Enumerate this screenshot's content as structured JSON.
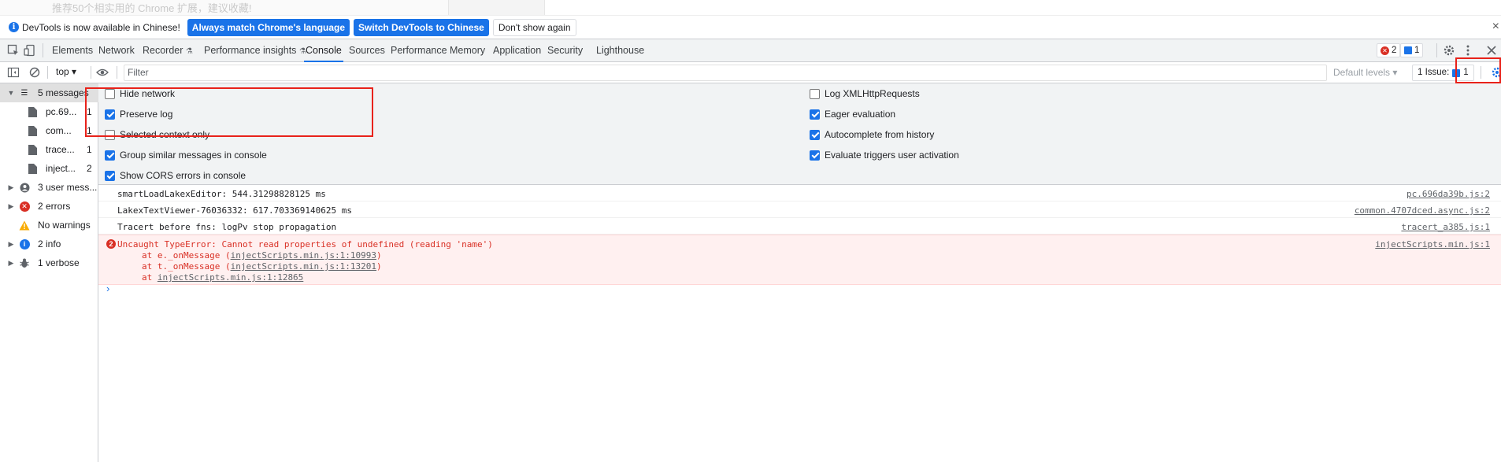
{
  "page_strip": {
    "text": "推荐50个相实用的 Chrome 扩展，建议收藏!"
  },
  "infobar": {
    "message": "DevTools is now available in Chinese!",
    "btn_match": "Always match Chrome's language",
    "btn_switch": "Switch DevTools to Chinese",
    "btn_dont": "Don't show again",
    "close": "×"
  },
  "tabs": {
    "elements": "Elements",
    "network": "Network",
    "recorder": "Recorder",
    "perf_insights": "Performance insights",
    "console": "Console",
    "sources": "Sources",
    "performance": "Performance",
    "memory": "Memory",
    "application": "Application",
    "security": "Security",
    "lighthouse": "Lighthouse",
    "error_count": "2",
    "issue_count": "1",
    "flask": "⚗"
  },
  "console_toolbar": {
    "context": "top ▾",
    "filter_placeholder": "Filter",
    "levels": "Default levels ▾",
    "issues_label": "1 Issue:",
    "issues_count": "1"
  },
  "sidebar": {
    "items": [
      {
        "label": "5 messages",
        "count": ""
      },
      {
        "label": "pc.69...",
        "count": "1"
      },
      {
        "label": "com...",
        "count": "1"
      },
      {
        "label": "trace...",
        "count": "1"
      },
      {
        "label": "inject...",
        "count": "2"
      },
      {
        "label": "3 user mess...",
        "count": ""
      },
      {
        "label": "2 errors",
        "count": ""
      },
      {
        "label": "No warnings",
        "count": ""
      },
      {
        "label": "2 info",
        "count": ""
      },
      {
        "label": "1 verbose",
        "count": ""
      }
    ]
  },
  "settings": {
    "hide_network": "Hide network",
    "preserve_log": "Preserve log",
    "selected_context": "Selected context only",
    "group_similar": "Group similar messages in console",
    "show_cors": "Show CORS errors in console",
    "log_xhr": "Log XMLHttpRequests",
    "eager_eval": "Eager evaluation",
    "autocomplete": "Autocomplete from history",
    "eval_triggers": "Evaluate triggers user activation"
  },
  "log": {
    "rows": [
      {
        "message": "smartLoadLakexEditor: 544.31298828125 ms",
        "source": "pc.696da39b.js:2"
      },
      {
        "message": "LakexTextViewer-76036332: 617.703369140625 ms",
        "source": "common.4707dced.async.js:2"
      },
      {
        "message": "Tracert before fns: logPv stop propagation",
        "source": "tracert_a385.js:1"
      }
    ],
    "error": {
      "count": "2",
      "message": "Uncaught TypeError: Cannot read properties of undefined (reading 'name')",
      "source": "injectScripts.min.js:1",
      "stack": [
        {
          "prefix": "at e._onMessage (",
          "link": "injectScripts.min.js:1:10993",
          "suffix": ")"
        },
        {
          "prefix": "at t._onMessage (",
          "link": "injectScripts.min.js:1:13201",
          "suffix": ")"
        },
        {
          "prefix": "at ",
          "link": "injectScripts.min.js:1:12865",
          "suffix": ""
        }
      ]
    },
    "prompt": "›"
  }
}
